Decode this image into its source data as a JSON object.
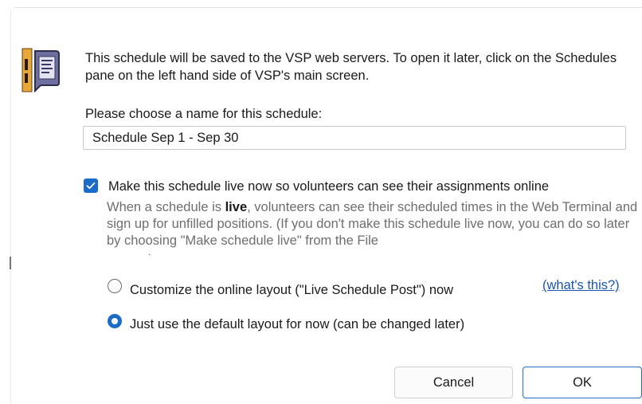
{
  "dialog": {
    "intro_text": "This schedule will be saved to the VSP web servers. To open it later, click on the Schedules pane on the left hand side of VSP's main screen.",
    "name_prompt": "Please choose a name for this schedule:",
    "name_value": "Schedule Sep 1 - Sep 30",
    "make_live": {
      "checked": true,
      "label": "Make this schedule live now so volunteers can see their assignments online",
      "desc_pre": "When a schedule is ",
      "desc_bold": "live",
      "desc_post": ", volunteers can see their scheduled times in the Web Terminal and sign up for unfilled positions. (If you don't make this schedule live now, you can do so later by choosing \"Make schedule live\" from the File"
    },
    "layout_options": [
      {
        "label": "Customize the online layout (\"Live Schedule Post\") now",
        "selected": false
      },
      {
        "label": "Just use the default layout for now (can be changed later)",
        "selected": true
      }
    ],
    "whats_this_link": "(what's this?)",
    "buttons": {
      "cancel": "Cancel",
      "ok": "OK"
    }
  },
  "colors": {
    "accent": "#1a6cc8",
    "link": "#1a55b5",
    "muted_text": "#6e6e6e"
  },
  "icons": {
    "dialog_icon": "schedule-document-icon"
  }
}
